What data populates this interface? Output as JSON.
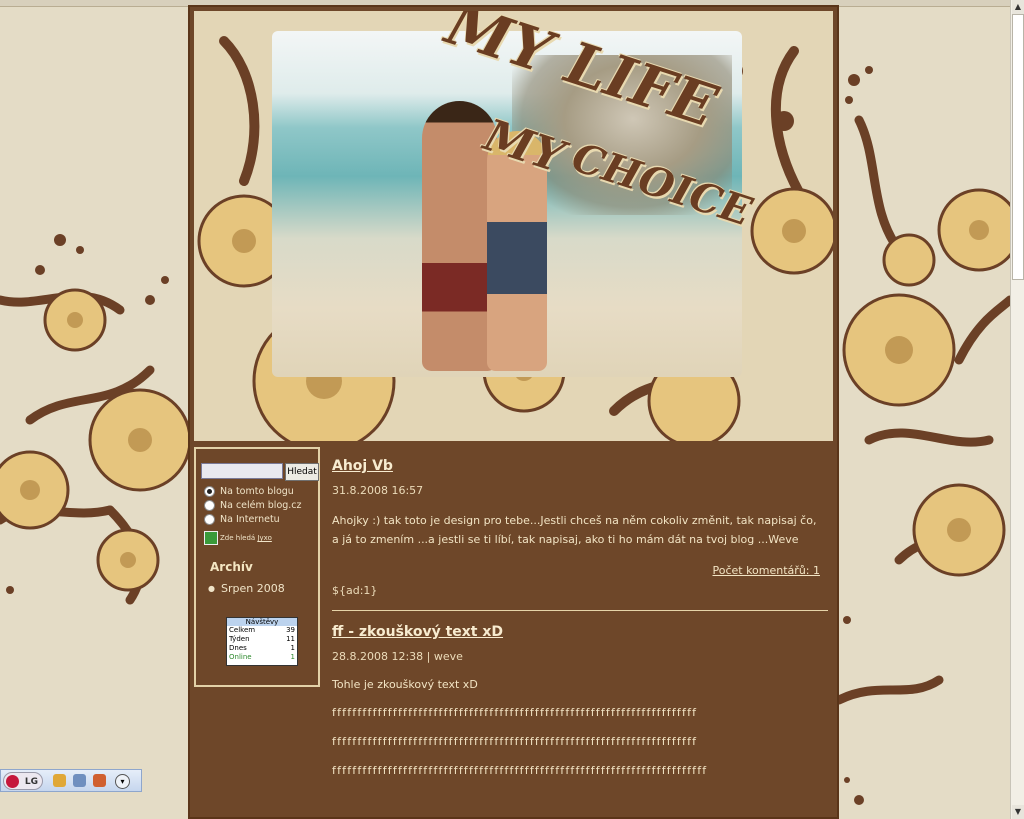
{
  "header": {
    "title_line1": "MY LIFE",
    "title_line2": "MY",
    "title_line3": "CHOICE"
  },
  "search": {
    "button_label": "Hledat",
    "input_value": "",
    "options": [
      "Na tomto blogu",
      "Na celém blog.cz",
      "Na Internetu"
    ],
    "selected_index": 0,
    "jyxo_label": "Zde hledá",
    "jyxo_link": "Jyxo"
  },
  "archive": {
    "title": "Archív",
    "items": [
      "Srpen 2008"
    ]
  },
  "counter": {
    "title": "Návštěvy",
    "rows": [
      {
        "label": "Celkem",
        "value": "39"
      },
      {
        "label": "Týden",
        "value": "11"
      },
      {
        "label": "Dnes",
        "value": "1"
      },
      {
        "label": "Online",
        "value": "1"
      }
    ]
  },
  "posts": [
    {
      "title": "Ahoj Vb",
      "date": "31.8.2008 16:57",
      "body": "Ahojky :) tak toto je design pro tebe...Jestli chceš na něm cokoliv změnit, tak napisaj čo, a já to zmením ...a jestli se ti líbí, tak napisaj, ako ti ho mám dát na tvoj blog ...Weve",
      "comments": "Počet komentářů: 1",
      "ad": "${ad:1}"
    },
    {
      "title": "ff - zkouškový text xD",
      "date": "28.8.2008 12:38",
      "author": "weve",
      "intro": "Tohle je zkouškový text xD",
      "lines": [
        "ffffffffffffffffffffffffffffffffffffffffffffffffffffffffffffffffffffffff",
        "ffffffffffffffffffffffffffffffffffffffffffffffffffffffffffffffffffffffff",
        "ffffffffffffffffffffffffffffffffffffffffffffffffffffffffffffffffffffffffff"
      ]
    }
  ],
  "taskbar": {
    "lg_label": "LG",
    "icons": [
      "compass-icon",
      "network-icon",
      "user-icon",
      "menu-dropdown-icon"
    ]
  },
  "colors": {
    "background": "#e4dcc6",
    "content_bg": "#6e4729",
    "flower": "#e6c57e",
    "swirl": "#6b4026"
  }
}
